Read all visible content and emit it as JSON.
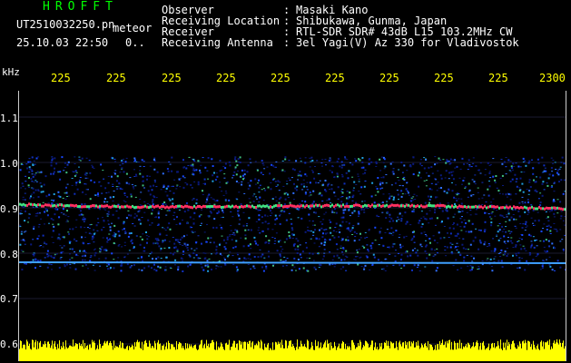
{
  "header": {
    "app": "HROFFT",
    "filename": "UT2510032250.pn",
    "mode": "meteor",
    "datetime": "25.10.03 22:50",
    "value": "0.."
  },
  "info": [
    {
      "label": "Observer",
      "value": "Masaki Kano"
    },
    {
      "label": "Receiving Location",
      "value": "Shibukawa, Gunma, Japan"
    },
    {
      "label": "Receiver",
      "value": "RTL-SDR SDR# 43dB L15 103.2MHz CW"
    },
    {
      "label": "Receiving Antenna",
      "value": "3el Yagi(V) Az 330 for Vladivostok"
    }
  ],
  "axis": {
    "y_unit": "kHz",
    "y_ticks": [
      "1.1",
      "1.0",
      "0.9",
      "0.8",
      "0.7",
      "0.6"
    ],
    "x_ticks": [
      "225",
      "225",
      "225",
      "225",
      "225",
      "225",
      "225",
      "225",
      "225",
      "2300"
    ]
  },
  "colors": {
    "accent_green": "#00ff00",
    "text_white": "#ffffff",
    "tick_yellow": "#ffff00",
    "carrier_red": "#ff3060",
    "noise_blue": "#1040ff"
  }
}
